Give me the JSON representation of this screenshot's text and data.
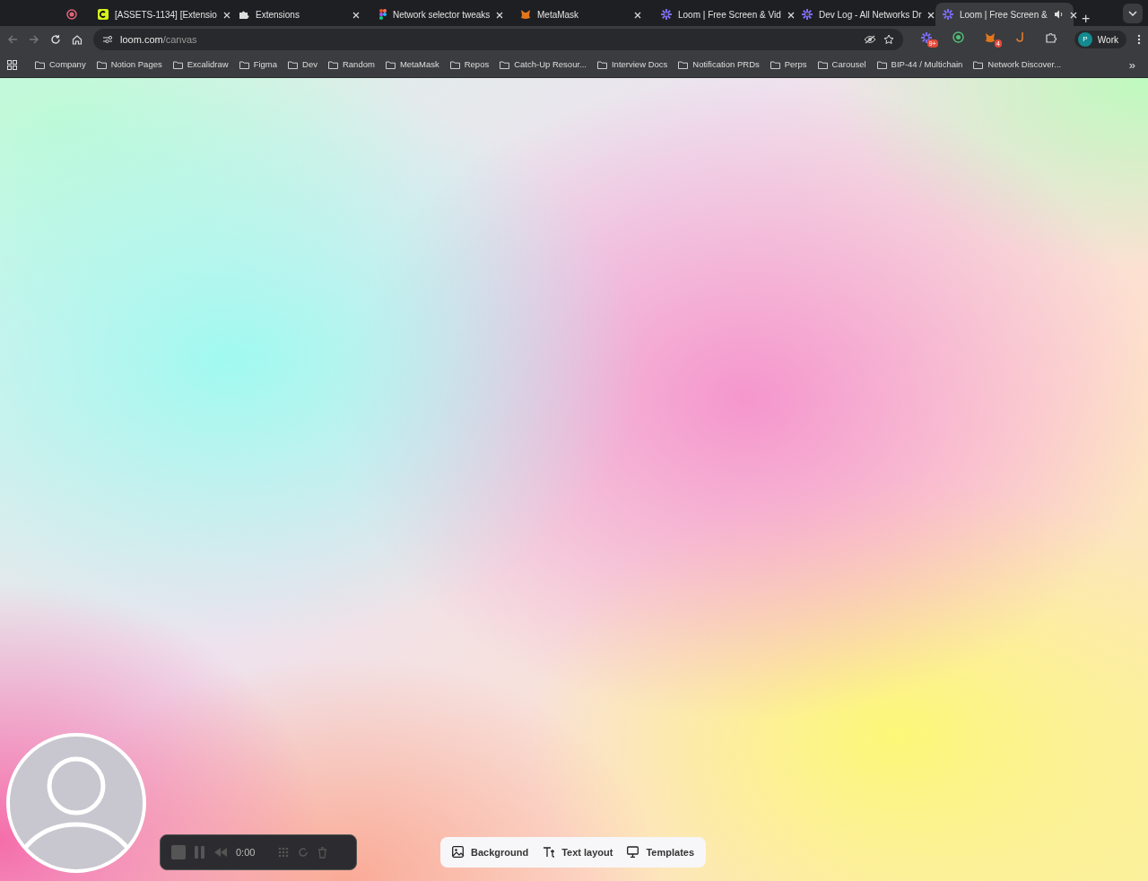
{
  "tabs": [
    {
      "kind": "pinned",
      "selected": false
    },
    {
      "kind": "linear",
      "title": "[ASSETS-1134] [Extensio",
      "selected": false
    },
    {
      "kind": "puzzle",
      "title": "Extensions",
      "selected": false
    },
    {
      "kind": "figma",
      "title": "Network selector tweaks",
      "selected": false
    },
    {
      "kind": "fox",
      "title": "MetaMask",
      "selected": false
    },
    {
      "kind": "loom",
      "title": "Loom | Free Screen & Vid",
      "selected": false
    },
    {
      "kind": "loom",
      "title": "Dev Log - All Networks Dr",
      "selected": false
    },
    {
      "kind": "loom",
      "title": "Loom | Free Screen &",
      "selected": true,
      "audio": true
    }
  ],
  "new_tab": "+",
  "address": {
    "host": "loom.com",
    "path": "/canvas"
  },
  "extensions": [
    {
      "kind": "loom",
      "badge": "9+"
    },
    {
      "kind": "ring"
    },
    {
      "kind": "fox",
      "badge": "4"
    },
    {
      "kind": "hook"
    },
    {
      "kind": "puzzle"
    }
  ],
  "profile": {
    "initial": "P",
    "label": "Work"
  },
  "bookmarks": [
    "Company",
    "Notion Pages",
    "Excalidraw",
    "Figma",
    "Dev",
    "Random",
    "MetaMask",
    "Repos",
    "Catch-Up Resour...",
    "Interview Docs",
    "Notification PRDs",
    "Perps",
    "Carousel",
    "BIP-44 / Multichain",
    "Network Discover..."
  ],
  "bookmarks_more": "»",
  "recorder": {
    "time": "0:00"
  },
  "canvas_tools": [
    {
      "kind": "image",
      "label": "Background"
    },
    {
      "kind": "text",
      "label": "Text layout"
    },
    {
      "kind": "monitor",
      "label": "Templates"
    }
  ]
}
